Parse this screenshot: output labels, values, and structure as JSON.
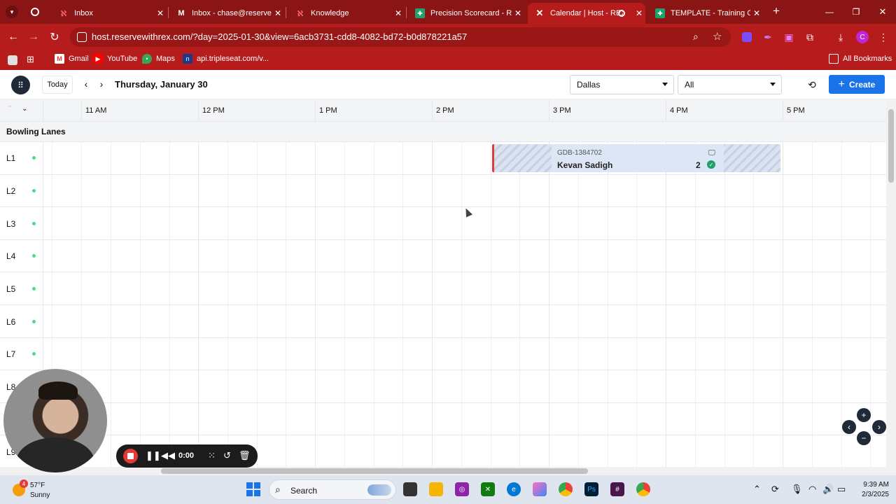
{
  "browser": {
    "tabs": [
      {
        "title": "Inbox",
        "favicon": "rex-icon",
        "color": "#e53935"
      },
      {
        "title": "Inbox - chase@reservewi",
        "favicon": "gmail-icon",
        "color": "#ffffff"
      },
      {
        "title": "Knowledge",
        "favicon": "rex-icon",
        "color": "#e53935"
      },
      {
        "title": "Precision Scorecard - Re",
        "favicon": "sheets-icon",
        "color": "#22a06b"
      },
      {
        "title": "Calendar | Host - REX",
        "favicon": "rex-x-icon",
        "color": "#ffffff"
      },
      {
        "title": "TEMPLATE - Training Che",
        "favicon": "sheets-icon",
        "color": "#22a06b"
      }
    ],
    "url": "host.reservewithrex.com/?day=2025-01-30&view=6acb3731-cdd8-4082-bd72-b0d878221a57",
    "profile_initial": "C",
    "bookmarks": [
      {
        "label": "Gmail",
        "icon": "gmail-icon"
      },
      {
        "label": "YouTube",
        "icon": "youtube-icon"
      },
      {
        "label": "Maps",
        "icon": "maps-icon"
      },
      {
        "label": "api.tripleseat.com/v...",
        "icon": "tripleseat-icon"
      }
    ],
    "all_bookmarks": "All Bookmarks"
  },
  "header": {
    "today": "Today",
    "date_title": "Thursday, January 30",
    "location": "Dallas",
    "filter": "All",
    "create": "Create"
  },
  "timeline": {
    "hours": [
      "11 AM",
      "12 PM",
      "1 PM",
      "2 PM",
      "3 PM",
      "4 PM",
      "5 PM"
    ]
  },
  "section": {
    "title": "Bowling Lanes",
    "lanes": [
      "L1",
      "L2",
      "L3",
      "L4",
      "L5",
      "L6",
      "L7",
      "L8",
      "L9"
    ]
  },
  "booking": {
    "id": "GDB-1384702",
    "name": "Kevan Sadigh",
    "count": "2",
    "accent": "#e53935"
  },
  "recorder": {
    "time": "0:00"
  },
  "taskbar": {
    "temp": "57°F",
    "condition": "Sunny",
    "weather_badge": "4",
    "search": "Search",
    "time": "9:39 AM",
    "date": "2/3/2025"
  }
}
